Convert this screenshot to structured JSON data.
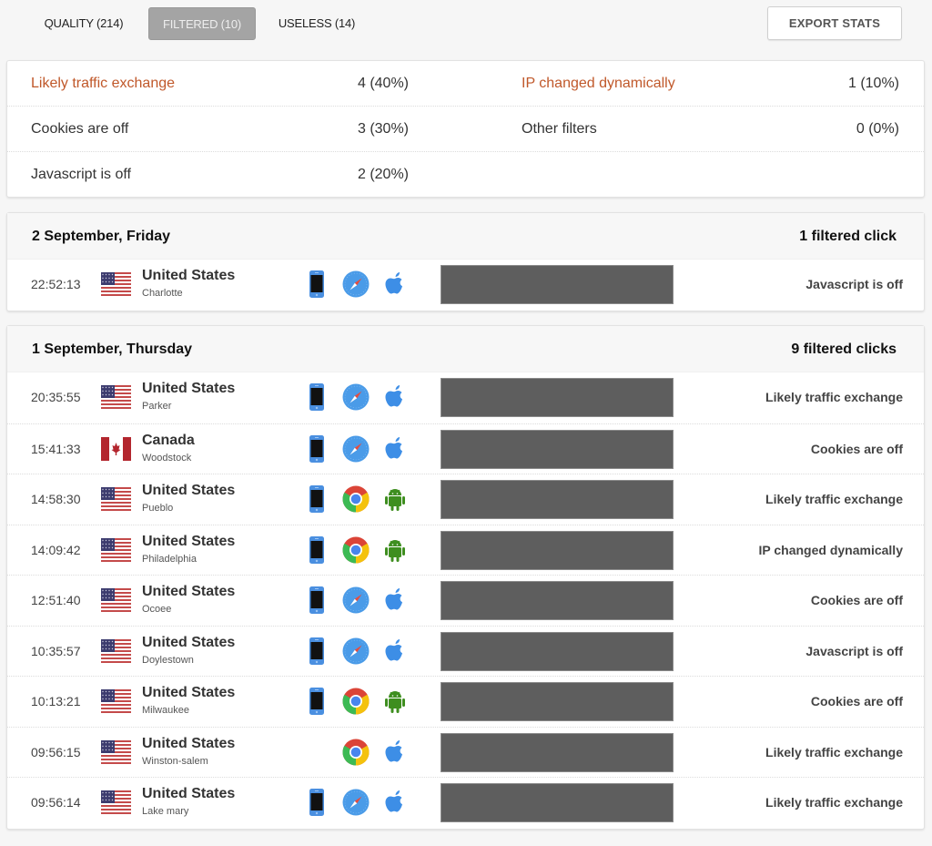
{
  "tabs": [
    {
      "label": "QUALITY (214)",
      "active": false
    },
    {
      "label": "FILTERED (10)",
      "active": true
    },
    {
      "label": "USELESS (14)",
      "active": false
    }
  ],
  "export_button": "EXPORT STATS",
  "colors": {
    "highlight": "#c0582a",
    "active_tab_bg": "#a4a4a4",
    "redacted": "#5e5e5e",
    "ios_blue": "#3d8ee6",
    "android_green": "#3e8e1f"
  },
  "summary": {
    "left": [
      {
        "label": "Likely traffic exchange",
        "value": "4 (40%)",
        "highlight": true
      },
      {
        "label": "Cookies are off",
        "value": "3 (30%)",
        "highlight": false
      },
      {
        "label": "Javascript is off",
        "value": "2 (20%)",
        "highlight": false
      }
    ],
    "right": [
      {
        "label": "IP changed dynamically",
        "value": "1 (10%)",
        "highlight": true
      },
      {
        "label": "Other filters",
        "value": "0 (0%)",
        "highlight": false
      }
    ]
  },
  "days": [
    {
      "title": "2 September, Friday",
      "count": "1 filtered click",
      "clicks": [
        {
          "time": "22:52:13",
          "flag": "us-flag",
          "country": "United States",
          "city": "Charlotte",
          "device": "mobile",
          "browser": "safari",
          "os": "apple",
          "reason": "Javascript is off"
        }
      ]
    },
    {
      "title": "1 September, Thursday",
      "count": "9 filtered clicks",
      "clicks": [
        {
          "time": "20:35:55",
          "flag": "us-flag",
          "country": "United States",
          "city": "Parker",
          "device": "mobile",
          "browser": "safari",
          "os": "apple",
          "reason": "Likely traffic exchange"
        },
        {
          "time": "15:41:33",
          "flag": "ca-flag",
          "country": "Canada",
          "city": "Woodstock",
          "device": "mobile",
          "browser": "safari",
          "os": "apple",
          "reason": "Cookies are off"
        },
        {
          "time": "14:58:30",
          "flag": "us-flag",
          "country": "United States",
          "city": "Pueblo",
          "device": "mobile",
          "browser": "chrome",
          "os": "android",
          "reason": "Likely traffic exchange"
        },
        {
          "time": "14:09:42",
          "flag": "us-flag",
          "country": "United States",
          "city": "Philadelphia",
          "device": "mobile",
          "browser": "chrome",
          "os": "android",
          "reason": "IP changed dynamically"
        },
        {
          "time": "12:51:40",
          "flag": "us-flag",
          "country": "United States",
          "city": "Ocoee",
          "device": "mobile",
          "browser": "safari",
          "os": "apple",
          "reason": "Cookies are off"
        },
        {
          "time": "10:35:57",
          "flag": "us-flag",
          "country": "United States",
          "city": "Doylestown",
          "device": "mobile",
          "browser": "safari",
          "os": "apple",
          "reason": "Javascript is off"
        },
        {
          "time": "10:13:21",
          "flag": "us-flag",
          "country": "United States",
          "city": "Milwaukee",
          "device": "mobile",
          "browser": "chrome",
          "os": "android",
          "reason": "Cookies are off"
        },
        {
          "time": "09:56:15",
          "flag": "us-flag",
          "country": "United States",
          "city": "Winston-salem",
          "device": "none",
          "browser": "chrome",
          "os": "apple",
          "reason": "Likely traffic exchange"
        },
        {
          "time": "09:56:14",
          "flag": "us-flag",
          "country": "United States",
          "city": "Lake mary",
          "device": "mobile",
          "browser": "safari",
          "os": "apple",
          "reason": "Likely traffic exchange"
        }
      ]
    }
  ]
}
